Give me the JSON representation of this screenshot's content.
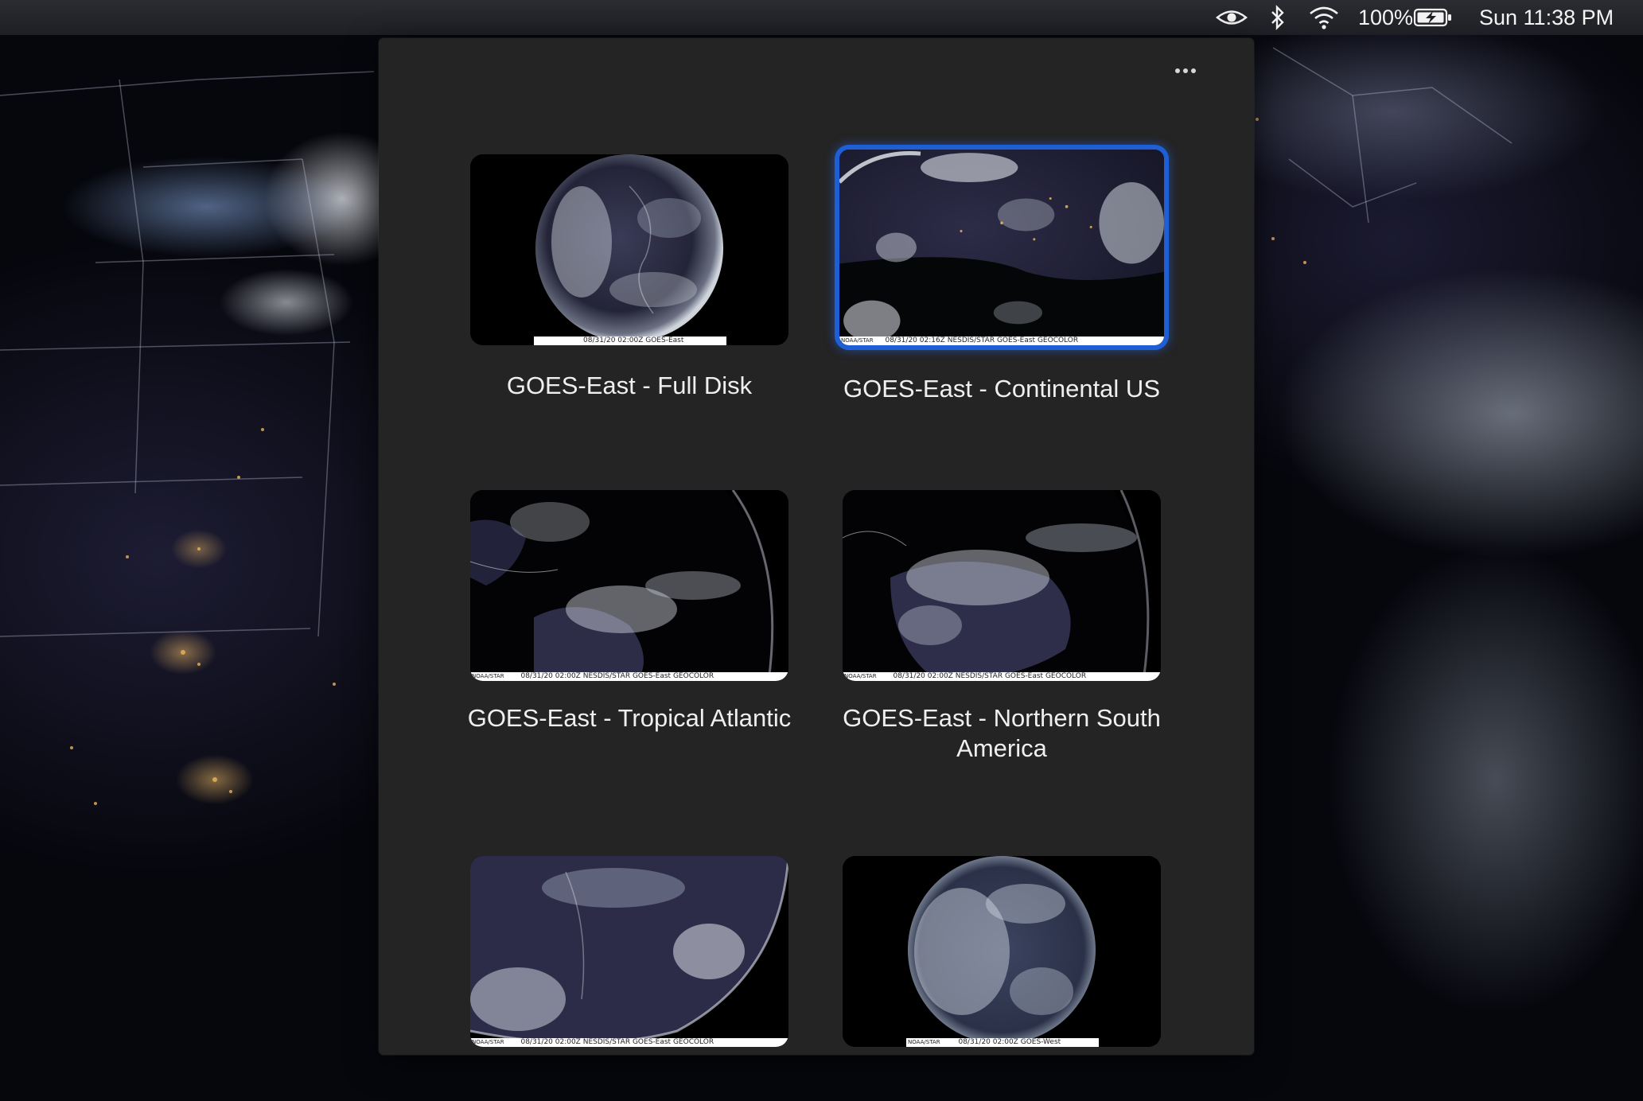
{
  "menubar": {
    "icons": [
      "eye-icon",
      "bluetooth-icon",
      "wifi-icon",
      "battery-charging-icon"
    ],
    "battery_percent": "100%",
    "clock": "Sun 11:38 PM"
  },
  "window": {
    "more_button_label": "•••",
    "tiles": [
      {
        "title": "GOES-East - Full Disk",
        "caption_left": "",
        "caption": "08/31/20 02:00Z GOES-East",
        "selected": false
      },
      {
        "title": "GOES-East - Continental US",
        "caption_left": "NOAA/STAR",
        "caption": "08/31/20 02:16Z NESDIS/STAR GOES-East GEOCOLOR",
        "selected": true
      },
      {
        "title": "GOES-East - Tropical Atlantic",
        "caption_left": "NOAA/STAR",
        "caption": "08/31/20 02:00Z NESDIS/STAR GOES-East GEOCOLOR",
        "selected": false
      },
      {
        "title": "GOES-East - Northern South America",
        "caption_left": "NOAA/STAR",
        "caption": "08/31/20 02:00Z NESDIS/STAR GOES-East GEOCOLOR",
        "selected": false
      },
      {
        "title": "",
        "caption_left": "NOAA/STAR",
        "caption": "08/31/20 02:00Z NESDIS/STAR GOES-East GEOCOLOR",
        "selected": false
      },
      {
        "title": "",
        "caption_left": "NOAA/STAR",
        "caption": "08/31/20 02:00Z GOES-West",
        "selected": false
      }
    ]
  },
  "colors": {
    "window_bg": "#242424",
    "selection": "#1f5fd6",
    "text": "#efefef"
  }
}
